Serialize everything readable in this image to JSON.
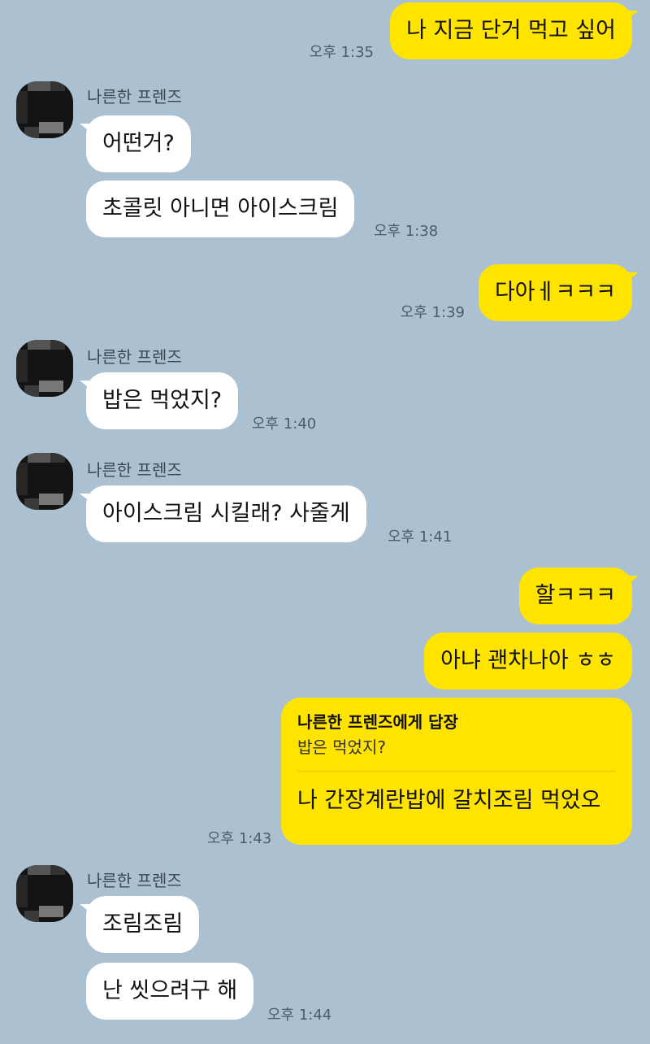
{
  "friend_name": "나른한 프렌즈",
  "messages": {
    "m1": {
      "text": "나 지금 단거 먹고 싶어",
      "time": "오후 1:35"
    },
    "m2": {
      "text": "어떤거?"
    },
    "m3": {
      "text": "초콜릿 아니면 아이스크림",
      "time": "오후 1:38"
    },
    "m4": {
      "text": "다아ㅔㅋㅋㅋ",
      "time": "오후 1:39"
    },
    "m5": {
      "text": "밥은 먹었지?",
      "time": "오후 1:40"
    },
    "m6": {
      "text": "아이스크림 시킬래? 사줄게",
      "time": "오후 1:41"
    },
    "m7": {
      "text": "할ㅋㅋㅋ"
    },
    "m8": {
      "text": "아냐 괜차나아 ㅎㅎ"
    },
    "m9": {
      "reply_title": "나른한 프렌즈에게 답장",
      "quoted": "밥은 먹었지?",
      "text": "나 간장계란밥에 갈치조림 먹었오",
      "time": "오후 1:43"
    },
    "m10": {
      "text": "조림조림"
    },
    "m11": {
      "text": "난 씻으려구 해",
      "time": "오후 1:44"
    }
  },
  "colors": {
    "background": "#abc1d1",
    "mine": "#ffe400",
    "theirs": "#ffffff"
  }
}
